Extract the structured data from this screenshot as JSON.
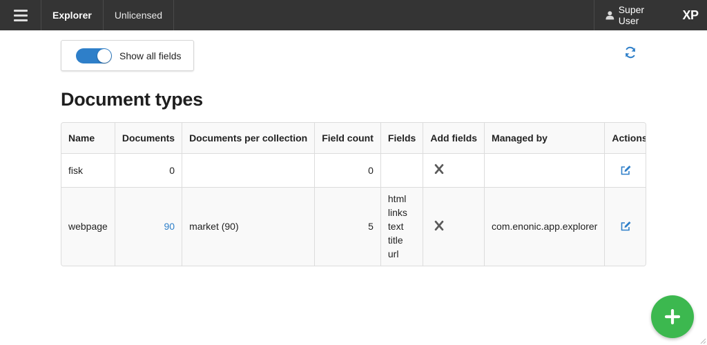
{
  "topbar": {
    "menu_icon": "hamburger-icon",
    "app_name": "Explorer",
    "license": "Unlicensed",
    "user_icon": "user-icon",
    "user_name": "Super User",
    "product": "XP"
  },
  "toolbar": {
    "show_all_fields_label": "Show all fields",
    "show_all_fields_on": true,
    "refresh_icon": "refresh-icon"
  },
  "main": {
    "title": "Document types",
    "table": {
      "headers": [
        "Name",
        "Documents",
        "Documents per collection",
        "Field count",
        "Fields",
        "Add fields",
        "Managed by",
        "Actions"
      ],
      "rows": [
        {
          "name": "fisk",
          "documents": "0",
          "documents_per_collection": "",
          "field_count": "0",
          "fields": [],
          "add_fields_icon": "x-icon",
          "managed_by": ""
        },
        {
          "name": "webpage",
          "documents": "90",
          "documents_per_collection": "market (90)",
          "field_count": "5",
          "fields": [
            "html",
            "links",
            "text",
            "title",
            "url"
          ],
          "add_fields_icon": "x-icon",
          "managed_by": "com.enonic.app.explorer"
        }
      ]
    }
  },
  "fab": {
    "icon": "plus-icon"
  },
  "colors": {
    "topbar_bg": "#343434",
    "accent_blue": "#2e7fc9",
    "delete_red": "#d94b4b",
    "fab_green": "#3cb84f"
  }
}
